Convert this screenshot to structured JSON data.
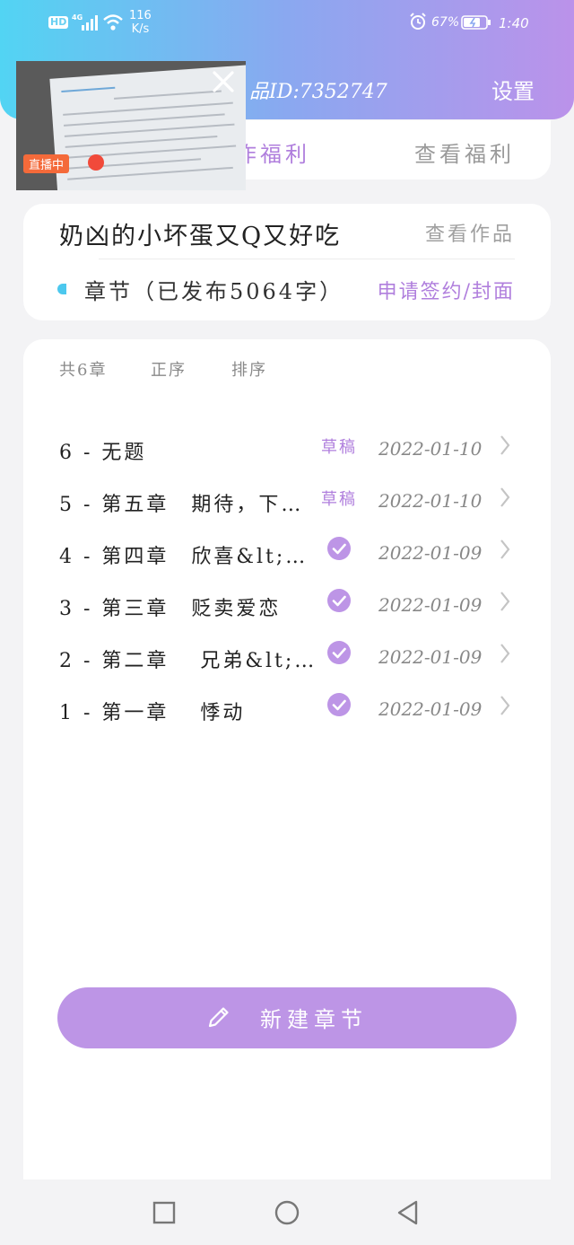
{
  "status_bar": {
    "speed_value": "116",
    "speed_unit": "K/s",
    "battery_percent": "67%",
    "time": "1:40",
    "network": "4G",
    "hd": "HD"
  },
  "header": {
    "title_id": "品ID:7352747",
    "settings_label": "设置"
  },
  "tabs": {
    "left_label": "作福利",
    "right_label": "查看福利"
  },
  "work": {
    "title": "奶凶的小坏蛋又Q又好吃",
    "view_label": "查看作品",
    "chapter_info": "章节（已发布5064字）",
    "apply_label": "申请签约/封面"
  },
  "list_meta": {
    "count": "共6章",
    "order": "正序",
    "sort": "排序"
  },
  "chapters": [
    {
      "name": "6 - 无题",
      "status": "草稿",
      "date": "2022-01-10"
    },
    {
      "name": "5 - 第五章　期待，下…",
      "status": "草稿",
      "date": "2022-01-10"
    },
    {
      "name": "4 - 第四章　欣喜&lt;…",
      "status": "published",
      "date": "2022-01-09"
    },
    {
      "name": "3 - 第三章　贬卖爱恋",
      "status": "published",
      "date": "2022-01-09"
    },
    {
      "name": "2 - 第二章　 兄弟&lt;…",
      "status": "published",
      "date": "2022-01-09"
    },
    {
      "name": "1 - 第一章　 悸动",
      "status": "published",
      "date": "2022-01-09"
    }
  ],
  "new_chapter_label": "新建章节",
  "pip": {
    "live_label": "直播中"
  },
  "colors": {
    "accent": "#bd95e6",
    "accent_text": "#b07fdd",
    "header_start": "#52d4f3",
    "header_end": "#bb92ea"
  }
}
